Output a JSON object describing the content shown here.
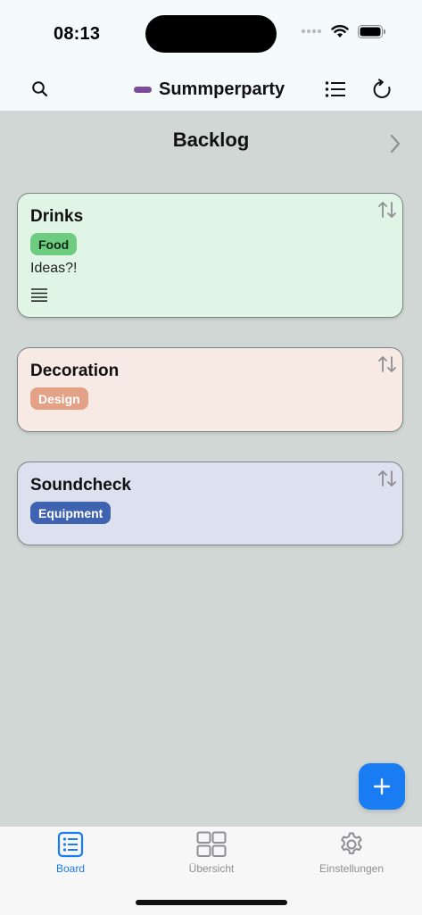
{
  "status_bar": {
    "time": "08:13"
  },
  "nav": {
    "title": "Summperparty",
    "board_color": "#7c4a9c"
  },
  "column": {
    "title": "Backlog"
  },
  "cards": [
    {
      "title": "Drinks",
      "tag": "Food",
      "tag_bg": "#6dcc80",
      "tag_fg": "#0d2a13",
      "bg": "#e0f5e5",
      "description": "Ideas?!"
    },
    {
      "title": "Decoration",
      "tag": "Design",
      "tag_bg": "#e3a286",
      "tag_fg": "#ffffff",
      "bg": "#f7e9e3"
    },
    {
      "title": "Soundcheck",
      "tag": "Equipment",
      "tag_bg": "#3f62b1",
      "tag_fg": "#ffffff",
      "bg": "#dce0ef"
    }
  ],
  "tabs": [
    {
      "label": "Board",
      "active": true
    },
    {
      "label": "Übersicht",
      "active": false
    },
    {
      "label": "Einstellungen",
      "active": false
    }
  ],
  "colors": {
    "accent": "#1a7cf3",
    "inactive": "#8e8e93"
  }
}
